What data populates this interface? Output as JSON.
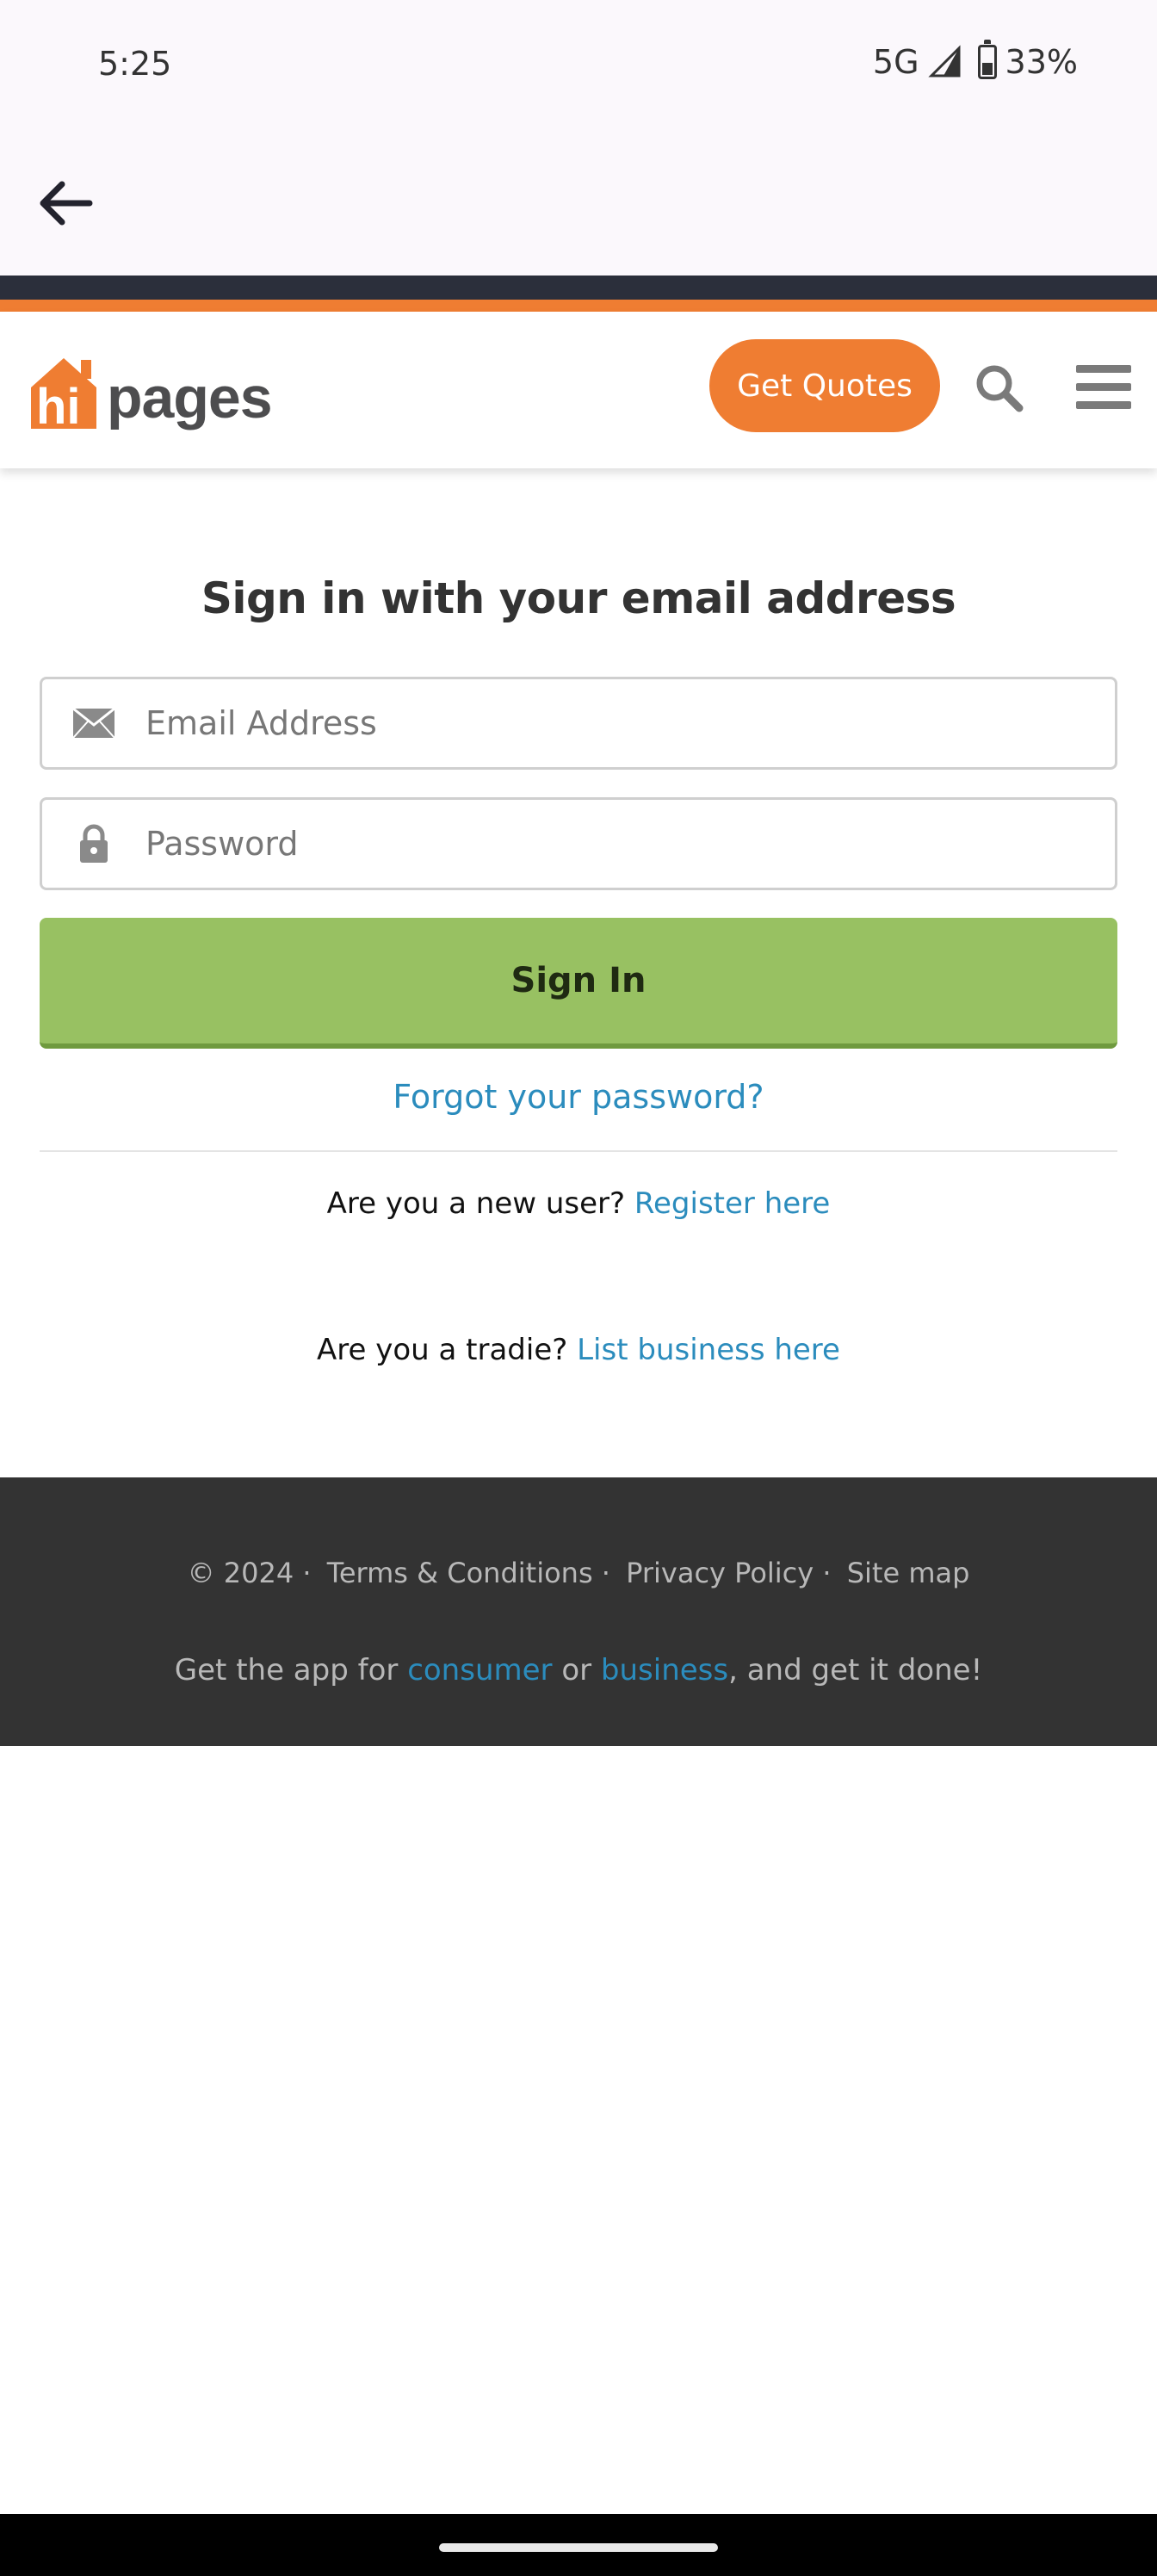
{
  "status_bar": {
    "time": "5:25",
    "network": "5G",
    "battery": "33%"
  },
  "header": {
    "logo_text": "hipages",
    "get_quotes_label": "Get Quotes"
  },
  "signin": {
    "title": "Sign in with your email address",
    "email_placeholder": "Email Address",
    "password_placeholder": "Password",
    "signin_label": "Sign In",
    "forgot_label": "Forgot your password?",
    "new_user_text": "Are you a new user?",
    "register_label": "Register here",
    "tradie_text": "Are you a tradie?",
    "list_business_label": "List business here"
  },
  "footer": {
    "copyright": "© 2024 ·",
    "terms_label": "Terms & Conditions ·",
    "privacy_label": "Privacy Policy ·",
    "sitemap_label": "Site map",
    "app_prefix": "Get the app for",
    "consumer_label": "consumer",
    "or_text": "or",
    "business_label": "business",
    "app_suffix": ", and get it done!"
  },
  "colors": {
    "brand_orange": "#ef7d32",
    "signin_green": "#98c162",
    "link_blue": "#2b8cbd",
    "footer_bg": "#333333"
  },
  "icons": [
    "back-arrow-icon",
    "signal-icon",
    "battery-icon",
    "search-icon",
    "menu-icon",
    "envelope-icon",
    "lock-icon"
  ]
}
